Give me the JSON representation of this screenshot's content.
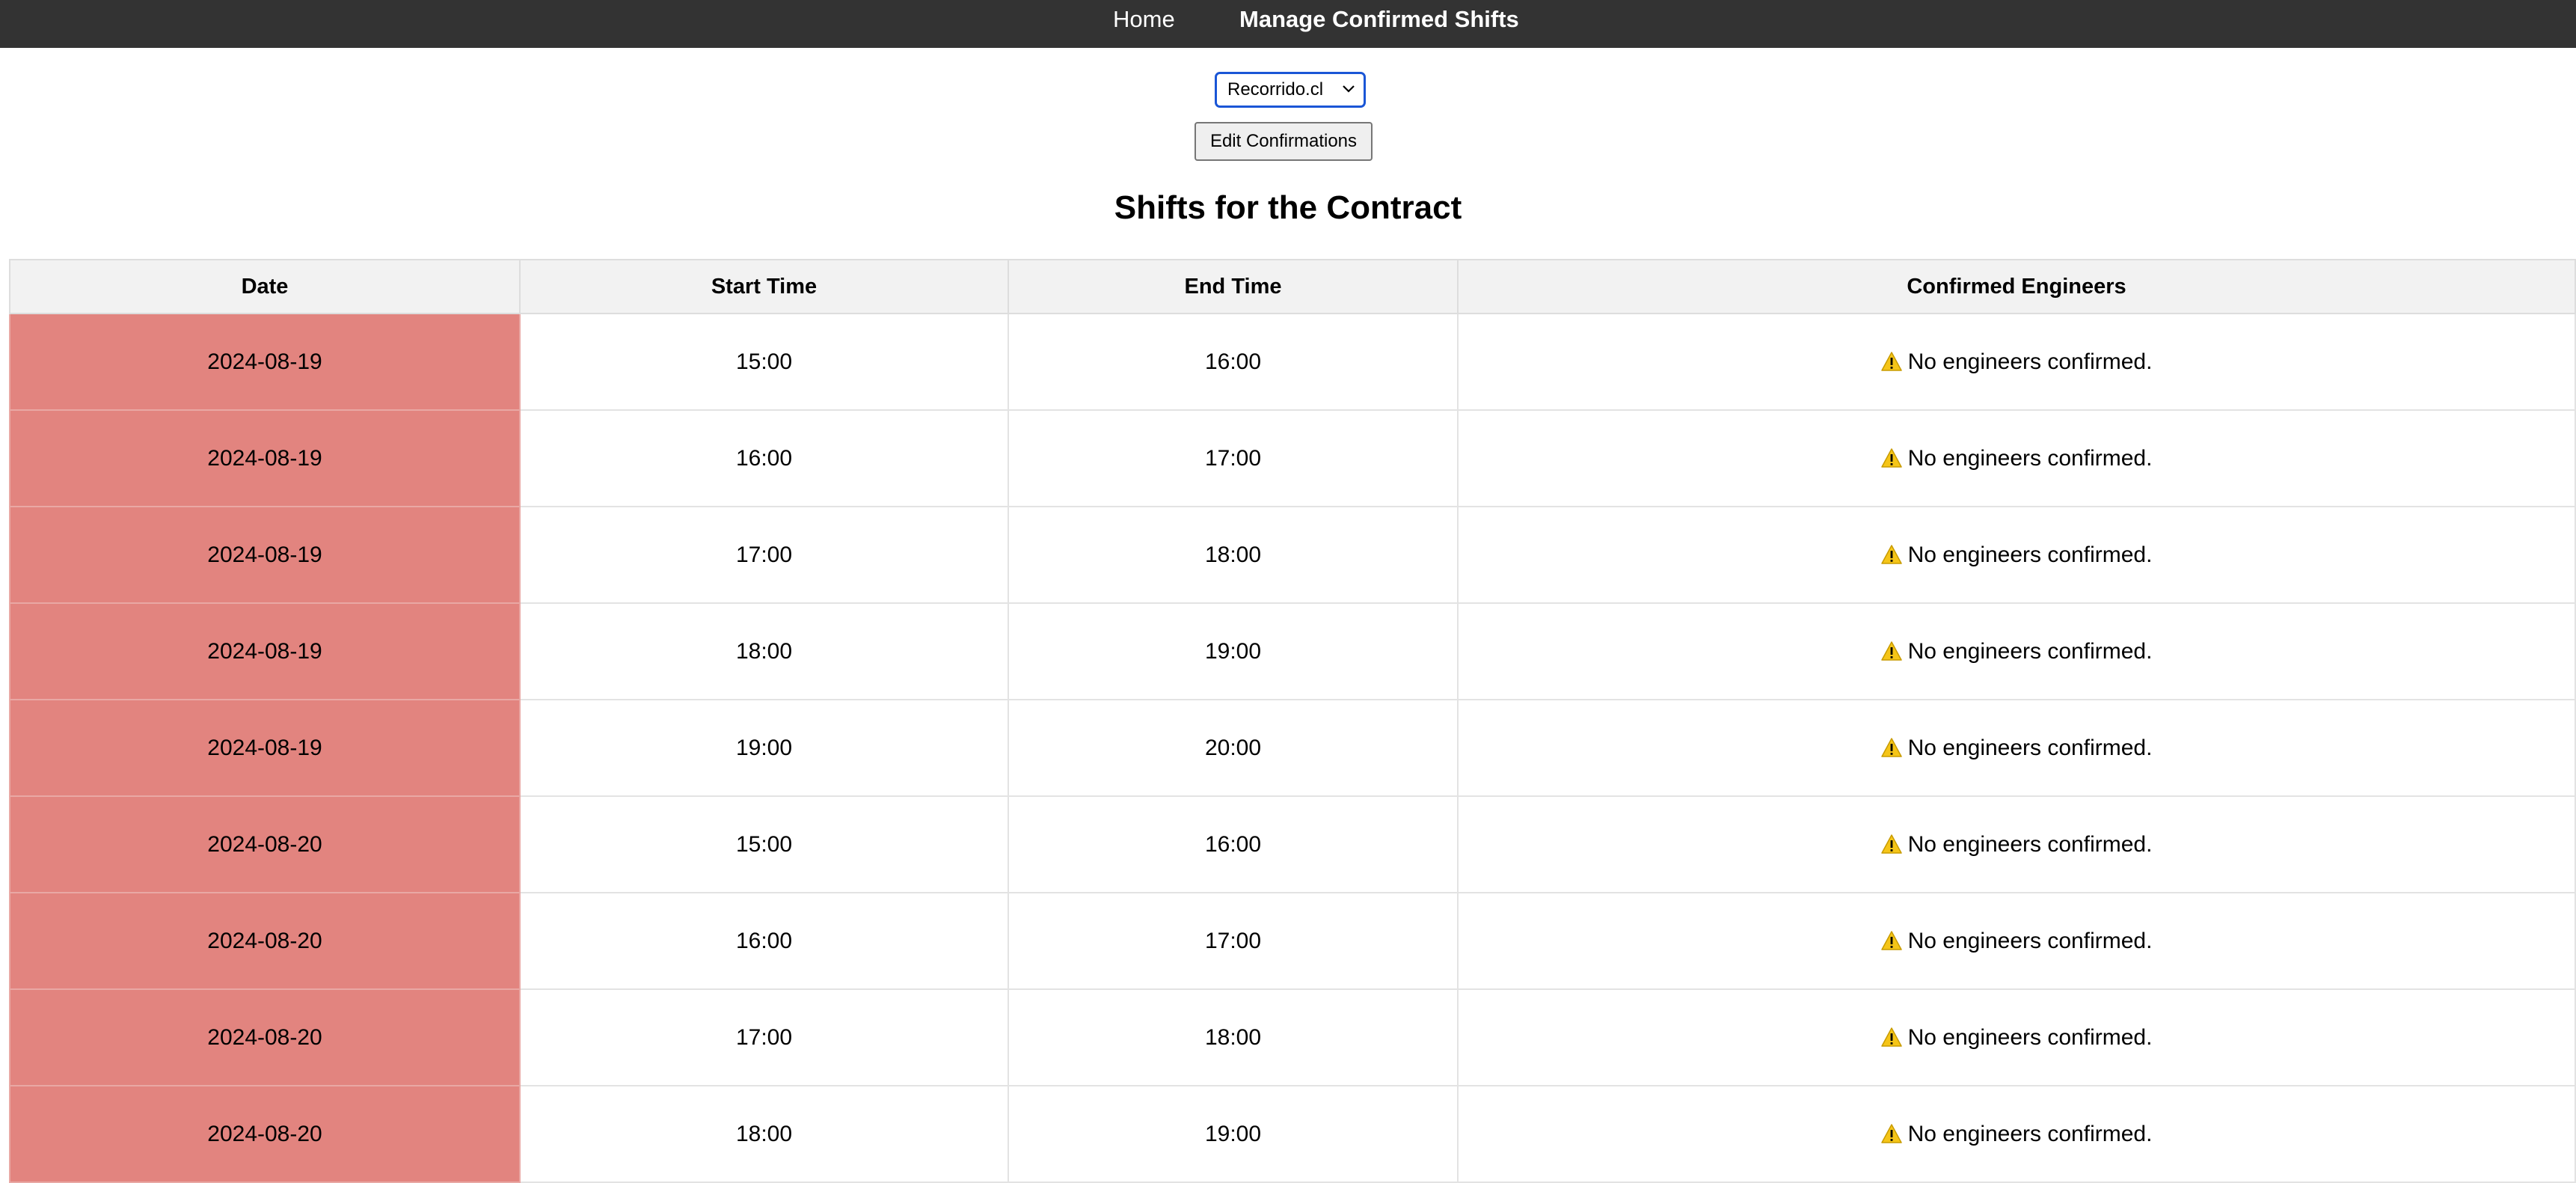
{
  "nav": {
    "home_label": "Home",
    "manage_label": "Manage Confirmed Shifts",
    "background_color": "#333333"
  },
  "controls": {
    "contract_select_value": "Recorrido.cl",
    "edit_button_label": "Edit Confirmations"
  },
  "page_title": "Shifts for the Contract",
  "table": {
    "headers": [
      "Date",
      "Start Time",
      "End Time",
      "Confirmed Engineers"
    ],
    "unconfirmed_date_color": "#e2847f",
    "warning_icon": "warning-icon",
    "rows": [
      {
        "date": "2024-08-19",
        "start": "15:00",
        "end": "16:00",
        "engineers": "No engineers confirmed."
      },
      {
        "date": "2024-08-19",
        "start": "16:00",
        "end": "17:00",
        "engineers": "No engineers confirmed."
      },
      {
        "date": "2024-08-19",
        "start": "17:00",
        "end": "18:00",
        "engineers": "No engineers confirmed."
      },
      {
        "date": "2024-08-19",
        "start": "18:00",
        "end": "19:00",
        "engineers": "No engineers confirmed."
      },
      {
        "date": "2024-08-19",
        "start": "19:00",
        "end": "20:00",
        "engineers": "No engineers confirmed."
      },
      {
        "date": "2024-08-20",
        "start": "15:00",
        "end": "16:00",
        "engineers": "No engineers confirmed."
      },
      {
        "date": "2024-08-20",
        "start": "16:00",
        "end": "17:00",
        "engineers": "No engineers confirmed."
      },
      {
        "date": "2024-08-20",
        "start": "17:00",
        "end": "18:00",
        "engineers": "No engineers confirmed."
      },
      {
        "date": "2024-08-20",
        "start": "18:00",
        "end": "19:00",
        "engineers": "No engineers confirmed."
      }
    ]
  }
}
